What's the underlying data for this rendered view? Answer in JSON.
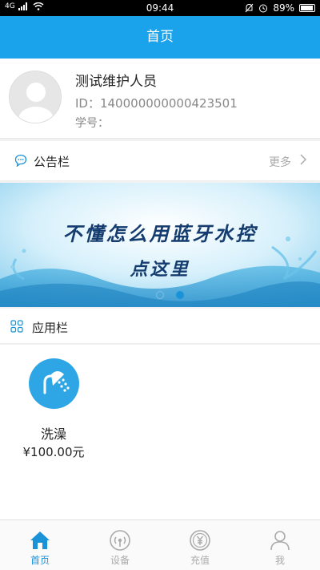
{
  "status_bar": {
    "signal": "4G",
    "time": "09:44",
    "battery": "89%"
  },
  "header": {
    "title": "首页"
  },
  "profile": {
    "name": "测试维护人员",
    "id_text": "ID：140000000000423501",
    "student_no_text": "学号："
  },
  "notice": {
    "title": "公告栏",
    "more": "更多"
  },
  "banner": {
    "line1": "不懂怎么用蓝牙水控",
    "line2": "点这里",
    "active_index": 1,
    "count": 2
  },
  "apps": {
    "title": "应用栏",
    "items": [
      {
        "name": "洗澡",
        "price": "¥100.00元",
        "icon": "shower-icon"
      }
    ]
  },
  "tabs": [
    {
      "label": "首页",
      "icon": "home-icon",
      "active": true
    },
    {
      "label": "设备",
      "icon": "device-signal-icon",
      "active": false
    },
    {
      "label": "充值",
      "icon": "yuan-coin-icon",
      "active": false
    },
    {
      "label": "我",
      "icon": "person-icon",
      "active": false
    }
  ],
  "colors": {
    "primary": "#1aa3ea",
    "tab_active": "#1a92d8",
    "tab_inactive": "#aaaaaa",
    "app_icon_bg": "#2ea6e6"
  }
}
